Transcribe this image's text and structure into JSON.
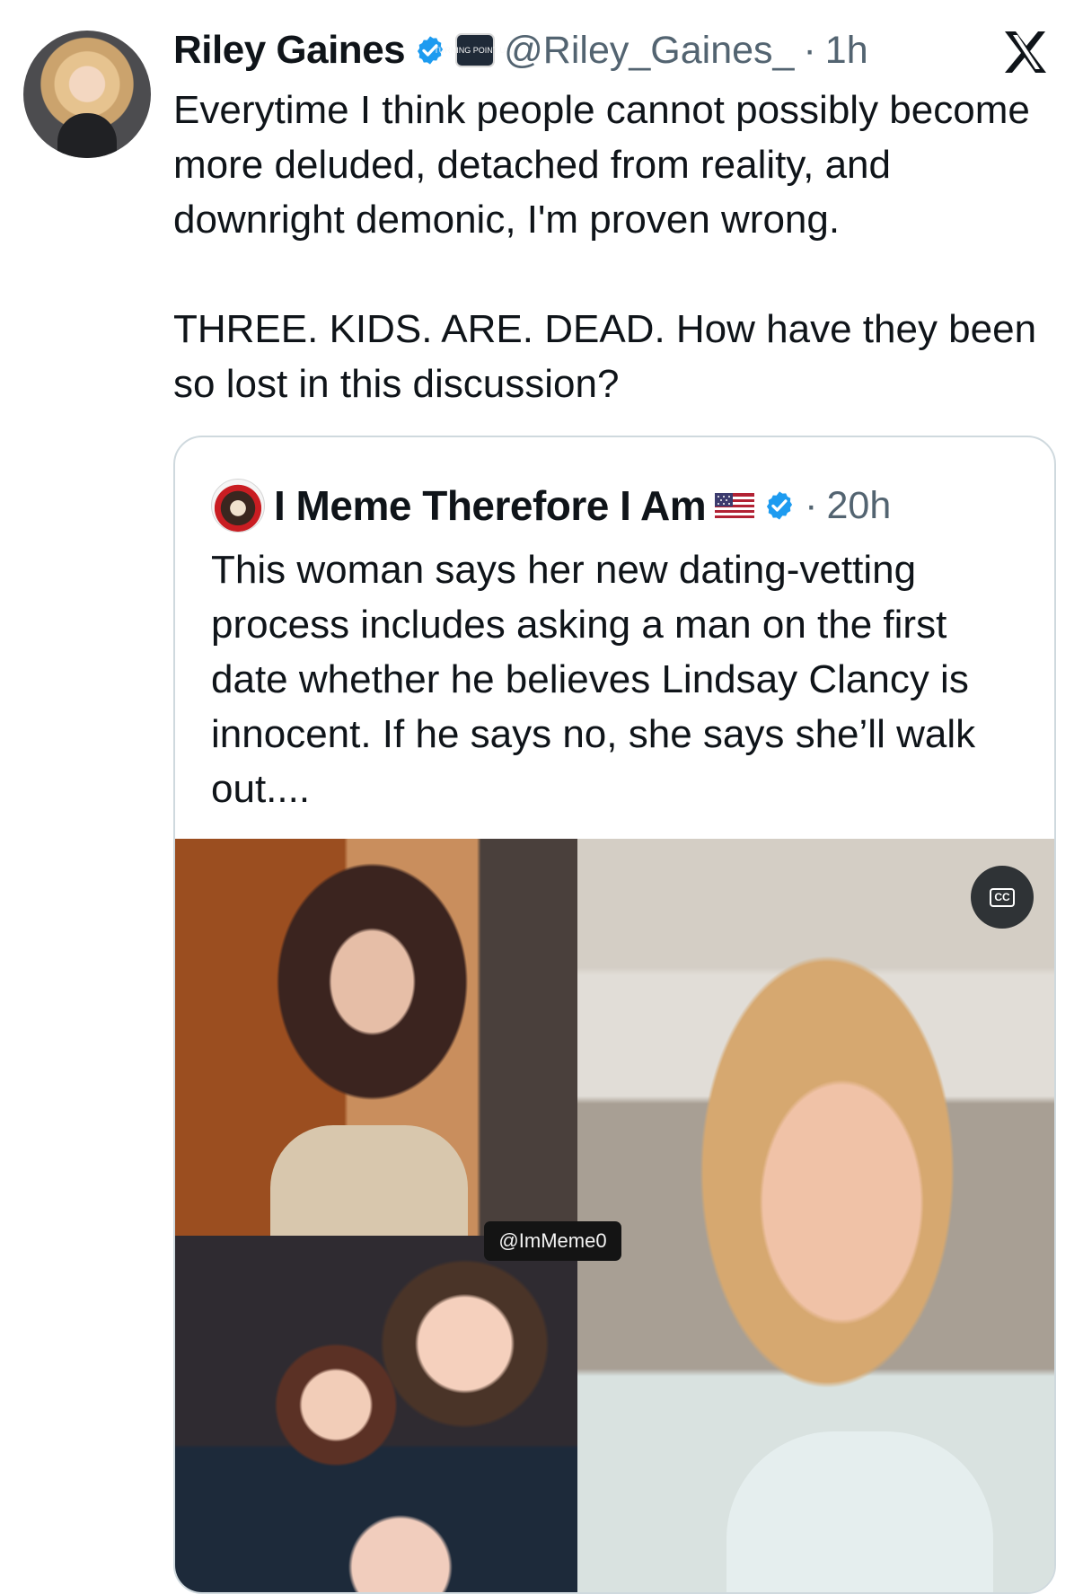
{
  "tweet": {
    "author": {
      "name": "Riley Gaines",
      "handle": "@Riley_Gaines_",
      "time": "1h",
      "affiliate_badge": "TURNING POINT USA"
    },
    "text": "Everytime I think people cannot possibly become more deluded, detached from reality, and downright demonic, I'm proven wrong.\n\nTHREE. KIDS. ARE. DEAD. How have they been so lost in this discussion?",
    "platform_logo": "X"
  },
  "quote": {
    "author": {
      "name": "I Meme Therefore I Am",
      "time": "20h"
    },
    "text": "This woman says her new dating-vetting process includes asking a man on the first date whether he believes Lindsay Clancy is innocent. If he says no, she says she’ll walk out....",
    "media": {
      "watermark": "@ImMeme0",
      "caption_button": "CC"
    }
  },
  "icons": {
    "verified": "verified-badge-icon",
    "platform": "x-logo-icon",
    "flag": "us-flag-icon",
    "captions": "closed-captions-icon"
  },
  "colors": {
    "text": "#0f1419",
    "secondary": "#536471",
    "verified": "#1d9bf0",
    "border": "#cfd9de"
  }
}
